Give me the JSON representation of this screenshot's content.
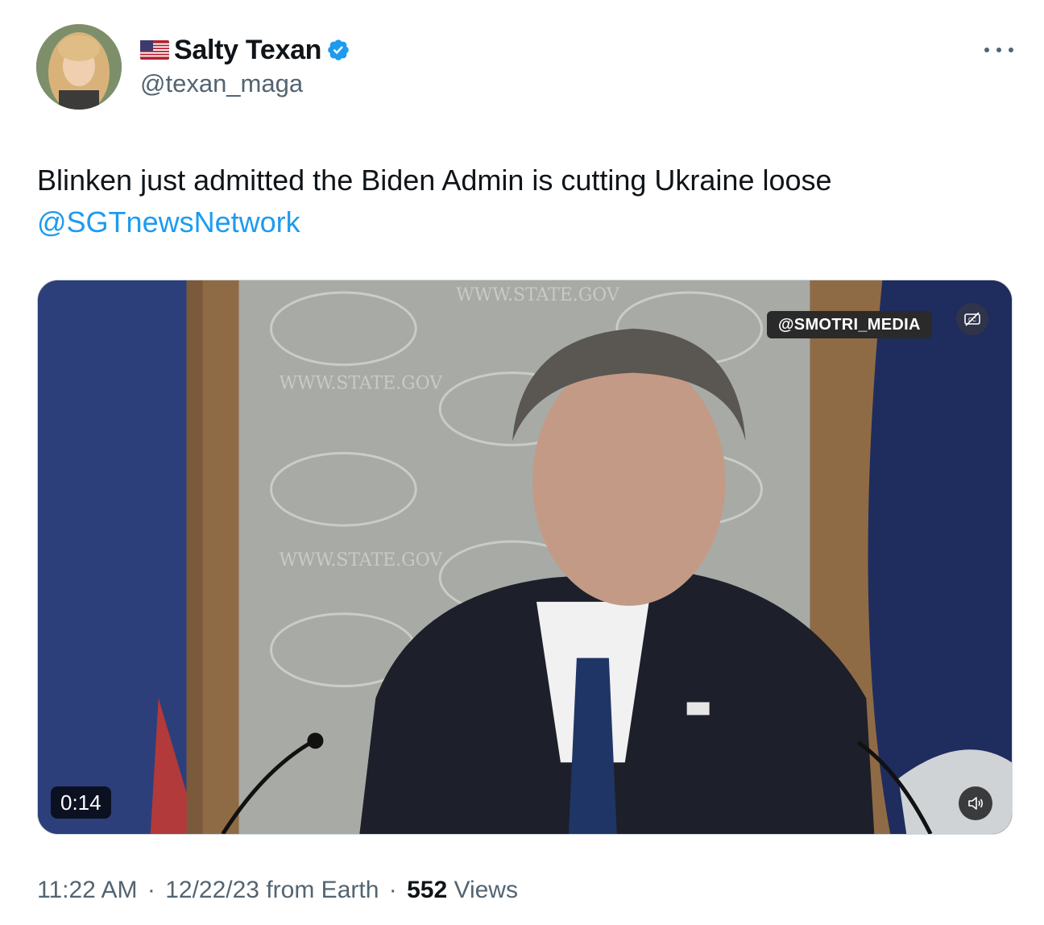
{
  "author": {
    "display_name": "Salty Texan",
    "handle": "@texan_maga",
    "flag_icon": "us-flag-icon",
    "verified_icon": "verified-badge-icon",
    "verified_color": "#1d9bf0"
  },
  "tweet": {
    "text": "Blinken just admitted the Biden Admin is cutting Ukraine loose",
    "mention": "@SGTnewsNetwork",
    "mention_color": "#1d9bf0"
  },
  "media": {
    "watermark": "@SMOTRI_MEDIA",
    "duration": "0:14",
    "captions_icon": "closed-captions-off-icon",
    "mute_icon": "speaker-icon",
    "background_text": "WWW.STATE.GOV",
    "overlay_text": "_MEDIA"
  },
  "meta": {
    "time": "11:22 AM",
    "separator": "·",
    "date": "12/22/23",
    "source": "from Earth",
    "views_count": "552",
    "views_label": "Views"
  },
  "more_icon": "ellipsis-icon"
}
